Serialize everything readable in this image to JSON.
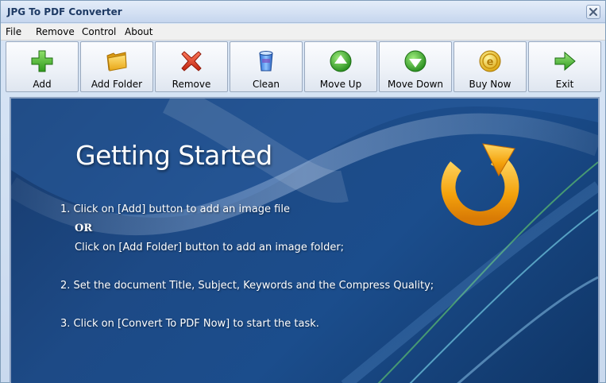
{
  "window": {
    "title": "JPG To PDF Converter"
  },
  "menu": [
    "File",
    "Remove",
    "Control",
    "About"
  ],
  "toolbar": [
    {
      "label": "Add",
      "icon": "add-icon"
    },
    {
      "label": "Add Folder",
      "icon": "folder-icon"
    },
    {
      "label": "Remove",
      "icon": "remove-icon"
    },
    {
      "label": "Clean",
      "icon": "clean-icon"
    },
    {
      "label": "Move Up",
      "icon": "move-up-icon"
    },
    {
      "label": "Move Down",
      "icon": "move-down-icon"
    },
    {
      "label": "Buy Now",
      "icon": "buy-now-icon"
    },
    {
      "label": "Exit",
      "icon": "exit-icon"
    }
  ],
  "content": {
    "heading": "Getting Started",
    "step1": "1. Click on [Add] button to add an image file",
    "or": "OR",
    "step1b": "Click on [Add Folder] button to add an image folder;",
    "step2": "2. Set the document Title, Subject, Keywords and the Compress Quality;",
    "step3": "3. Click on [Convert To PDF Now] to start the task."
  },
  "colors": {
    "accent": "#1e3a64",
    "content_bg": "#1d4a86",
    "add_green": "#3fae2a",
    "remove_red": "#d8321f",
    "refresh_orange": "#f2a70f"
  }
}
